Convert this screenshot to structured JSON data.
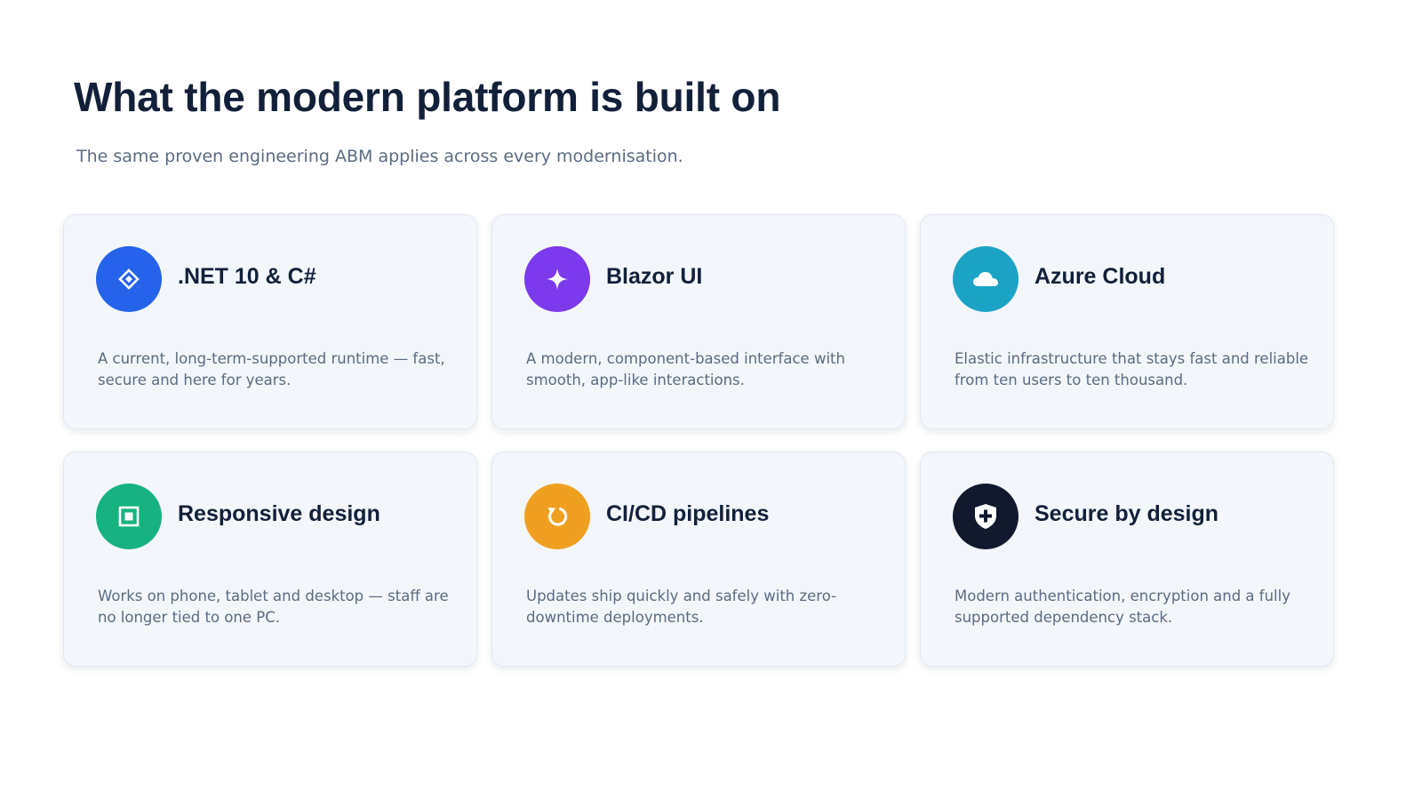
{
  "title": "What the modern platform is built on",
  "subtitle": "The same proven engineering ABM applies across every modernisation.",
  "cards": [
    {
      "title": ".NET 10 & C#",
      "description": "A current, long-term-supported runtime — fast, secure and here for years.",
      "icon": "diamond-icon",
      "color": "#2563eb"
    },
    {
      "title": "Blazor UI",
      "description": "A modern, component-based interface with smooth, app-like interactions.",
      "icon": "sparkle-icon",
      "color": "#7c3aed"
    },
    {
      "title": "Azure Cloud",
      "description": "Elastic infrastructure that stays fast and reliable from ten users to ten thousand.",
      "icon": "cloud-icon",
      "color": "#1aa3c4"
    },
    {
      "title": "Responsive design",
      "description": "Works on phone, tablet and desktop — staff are no longer tied to one PC.",
      "icon": "square-icon",
      "color": "#16b380"
    },
    {
      "title": "CI/CD pipelines",
      "description": "Updates ship quickly and safely with zero-downtime deployments.",
      "icon": "refresh-icon",
      "color": "#f0a021"
    },
    {
      "title": "Secure by design",
      "description": "Modern authentication, encryption and a fully supported dependency stack.",
      "icon": "shield-icon",
      "color": "#12192e"
    }
  ]
}
